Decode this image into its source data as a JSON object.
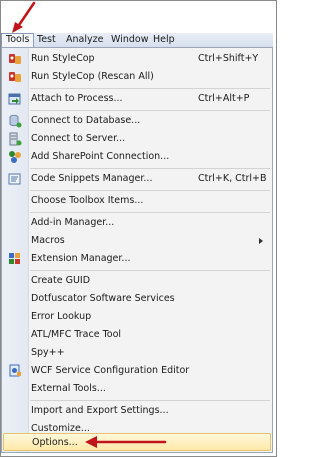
{
  "menubar": {
    "items": [
      {
        "label": "Tools"
      },
      {
        "label": "Test"
      },
      {
        "label": "Analyze"
      },
      {
        "label": "Window"
      },
      {
        "label": "Help"
      }
    ]
  },
  "tools_menu": {
    "items": [
      {
        "label": "Run StyleCop",
        "shortcut": "Ctrl+Shift+Y",
        "icon": "stylecop-icon"
      },
      {
        "label": "Run StyleCop (Rescan All)",
        "shortcut": "",
        "icon": "stylecop-icon"
      },
      {
        "label": "Attach to Process...",
        "shortcut": "Ctrl+Alt+P",
        "icon": "attach-process-icon"
      },
      {
        "label": "Connect to Database...",
        "shortcut": "",
        "icon": "database-icon"
      },
      {
        "label": "Connect to Server...",
        "shortcut": "",
        "icon": "server-icon"
      },
      {
        "label": "Add SharePoint Connection...",
        "shortcut": "",
        "icon": "sharepoint-icon"
      },
      {
        "label": "Code Snippets Manager...",
        "shortcut": "Ctrl+K, Ctrl+B",
        "icon": "snippets-icon"
      },
      {
        "label": "Choose Toolbox Items...",
        "shortcut": "",
        "icon": ""
      },
      {
        "label": "Add-in Manager...",
        "shortcut": "",
        "icon": ""
      },
      {
        "label": "Macros",
        "shortcut": "",
        "icon": ""
      },
      {
        "label": "Extension Manager...",
        "shortcut": "",
        "icon": "extension-icon"
      },
      {
        "label": "Create GUID",
        "shortcut": "",
        "icon": ""
      },
      {
        "label": "Dotfuscator Software Services",
        "shortcut": "",
        "icon": ""
      },
      {
        "label": "Error Lookup",
        "shortcut": "",
        "icon": ""
      },
      {
        "label": "ATL/MFC Trace Tool",
        "shortcut": "",
        "icon": ""
      },
      {
        "label": "Spy++",
        "shortcut": "",
        "icon": ""
      },
      {
        "label": "WCF Service Configuration Editor",
        "shortcut": "",
        "icon": "wcf-icon"
      },
      {
        "label": "External Tools...",
        "shortcut": "",
        "icon": ""
      },
      {
        "label": "Import and Export Settings...",
        "shortcut": "",
        "icon": ""
      },
      {
        "label": "Customize...",
        "shortcut": "",
        "icon": ""
      },
      {
        "label": "Options...",
        "shortcut": "",
        "icon": ""
      }
    ]
  },
  "colors": {
    "highlight": "#ffe9a8",
    "annotation_arrow": "#c0161b"
  }
}
